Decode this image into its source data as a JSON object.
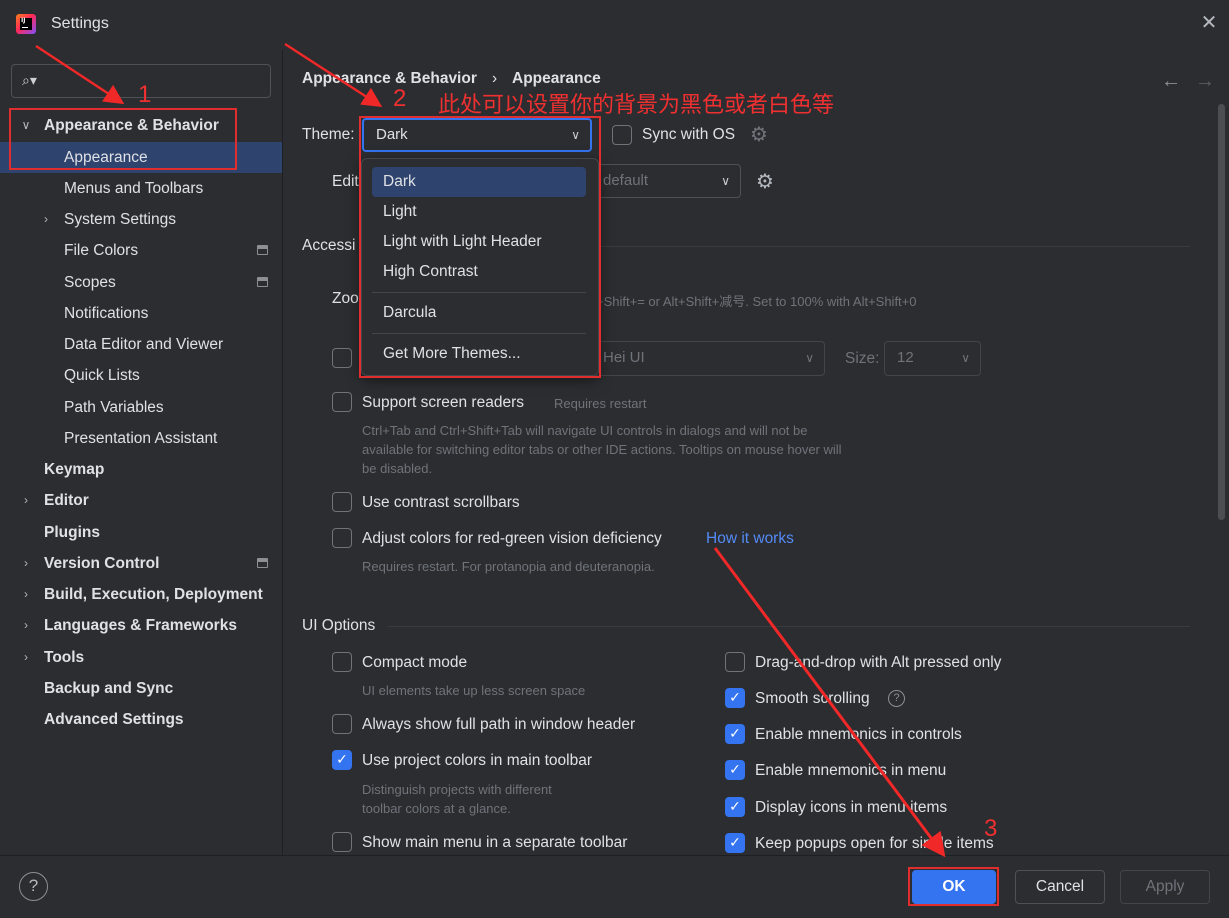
{
  "window": {
    "title": "Settings",
    "close": "✕"
  },
  "sidebar": {
    "search_icon": "⌕▾",
    "items": [
      {
        "label": "Appearance & Behavior",
        "chevron": "∨"
      },
      {
        "label": "Appearance"
      },
      {
        "label": "Menus and Toolbars"
      },
      {
        "label": "System Settings",
        "chevron": "›"
      },
      {
        "label": "File Colors"
      },
      {
        "label": "Scopes"
      },
      {
        "label": "Notifications"
      },
      {
        "label": "Data Editor and Viewer"
      },
      {
        "label": "Quick Lists"
      },
      {
        "label": "Path Variables"
      },
      {
        "label": "Presentation Assistant"
      },
      {
        "label": "Keymap"
      },
      {
        "label": "Editor",
        "chevron": "›"
      },
      {
        "label": "Plugins"
      },
      {
        "label": "Version Control",
        "chevron": "›"
      },
      {
        "label": "Build, Execution, Deployment",
        "chevron": "›"
      },
      {
        "label": "Languages & Frameworks",
        "chevron": "›"
      },
      {
        "label": "Tools",
        "chevron": "›"
      },
      {
        "label": "Backup and Sync"
      },
      {
        "label": "Advanced Settings"
      }
    ]
  },
  "breadcrumb": {
    "parent": "Appearance & Behavior",
    "sep": "›",
    "current": "Appearance",
    "back": "←",
    "forward": "→"
  },
  "theme": {
    "label": "Theme:",
    "value": "Dark",
    "arrow": "∨",
    "sync_label": "Sync with OS",
    "options": [
      "Dark",
      "Light",
      "Light with Light Header",
      "High Contrast",
      "Darcula",
      "Get More Themes..."
    ]
  },
  "editor_scheme": {
    "label": "Edit",
    "value": "default",
    "arrow": "∨"
  },
  "accessibility": {
    "title": "Accessi",
    "zoom_label": "Zoo",
    "zoom_hint": "+Shift+= or Alt+Shift+减号. Set to 100% with Alt+Shift+0",
    "font_value": "Hei UI",
    "font_arrow": "∨",
    "size_label": "Size:",
    "size_value": "12",
    "size_arrow": "∨",
    "screen_readers": "Support screen readers",
    "screen_readers_note": "Requires restart",
    "screen_readers_desc": [
      "Ctrl+Tab and Ctrl+Shift+Tab will navigate UI controls in dialogs and will not be",
      "available for switching editor tabs or other IDE actions. Tooltips on mouse hover will",
      "be disabled."
    ],
    "contrast_scrollbars": "Use contrast scrollbars",
    "color_deficiency": "Adjust colors for red-green vision deficiency",
    "how_it_works": "How it works",
    "color_deficiency_desc": "Requires restart. For protanopia and deuteranopia."
  },
  "ui_options": {
    "title": "UI Options",
    "left": [
      {
        "label": "Compact mode",
        "checked": false,
        "desc": "UI elements take up less screen space"
      },
      {
        "label": "Always show full path in window header",
        "checked": false
      },
      {
        "label": "Use project colors in main toolbar",
        "checked": true,
        "desc": [
          "Distinguish projects with different",
          "toolbar colors at a glance."
        ]
      },
      {
        "label": "Show main menu in a separate toolbar",
        "checked": false
      }
    ],
    "right": [
      {
        "label": "Drag-and-drop with Alt pressed only",
        "checked": false
      },
      {
        "label": "Smooth scrolling",
        "checked": true
      },
      {
        "label": "Enable mnemonics in controls",
        "checked": true
      },
      {
        "label": "Enable mnemonics in menu",
        "checked": true
      },
      {
        "label": "Display icons in menu items",
        "checked": true
      },
      {
        "label": "Keep popups open for single items",
        "checked": true
      }
    ]
  },
  "footer": {
    "help": "?",
    "ok": "OK",
    "cancel": "Cancel",
    "apply": "Apply"
  },
  "annotations": {
    "n1": "1",
    "n2": "2",
    "n3": "3",
    "note": "此处可以设置你的背景为黑色或者白色等"
  },
  "colors": {
    "accent": "#3574f0",
    "selection": "#2e436e",
    "annotation": "#e02e2e",
    "link": "#548af7"
  }
}
